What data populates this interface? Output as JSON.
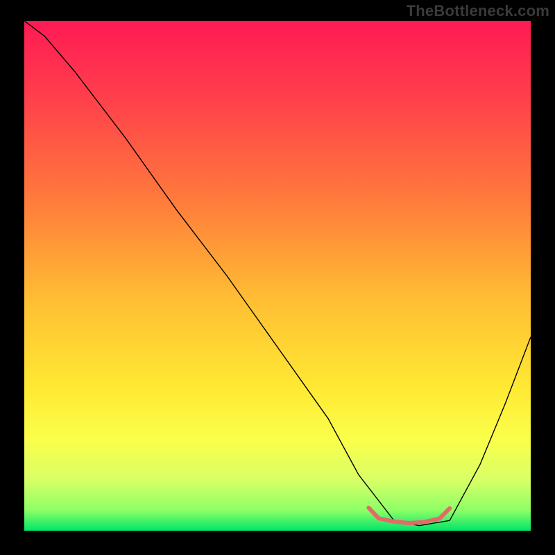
{
  "watermark": "TheBottleneck.com",
  "chart_data": {
    "type": "line",
    "title": "",
    "xlabel": "",
    "ylabel": "",
    "xlim": [
      0,
      100
    ],
    "ylim": [
      0,
      100
    ],
    "background_gradient": {
      "stops": [
        {
          "offset": 0,
          "color": "#ff1a55"
        },
        {
          "offset": 15,
          "color": "#ff3f4b"
        },
        {
          "offset": 35,
          "color": "#ff7a3c"
        },
        {
          "offset": 55,
          "color": "#ffbf33"
        },
        {
          "offset": 72,
          "color": "#ffe933"
        },
        {
          "offset": 82,
          "color": "#faff4a"
        },
        {
          "offset": 90,
          "color": "#d9ff66"
        },
        {
          "offset": 96,
          "color": "#8dff66"
        },
        {
          "offset": 100,
          "color": "#00e56a"
        }
      ]
    },
    "series": [
      {
        "name": "bottleneck-curve",
        "stroke": "#000000",
        "stroke_width": 1.4,
        "x": [
          0,
          4,
          10,
          20,
          30,
          40,
          50,
          60,
          66,
          73,
          78,
          84,
          90,
          95,
          100
        ],
        "y": [
          100,
          97,
          90,
          77,
          63,
          50,
          36,
          22,
          11,
          2,
          1,
          2,
          13,
          25,
          38
        ]
      }
    ],
    "highlight": {
      "name": "optimal-band",
      "stroke": "#e46a6a",
      "stroke_width": 6,
      "linecap": "round",
      "x": [
        68,
        70,
        73,
        76,
        79,
        82,
        84
      ],
      "y": [
        4.5,
        2.4,
        1.8,
        1.5,
        1.7,
        2.4,
        4.4
      ]
    }
  }
}
